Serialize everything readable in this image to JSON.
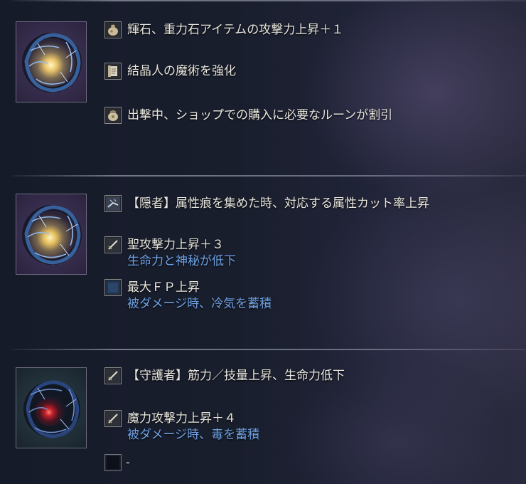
{
  "relics": [
    {
      "icon": "purple-golden-relic",
      "effects": [
        {
          "icon": "stone-pouch-icon",
          "text": "輝石、重力石アイテムの攻撃力上昇＋１"
        },
        {
          "icon": "scroll-icon",
          "text": "結晶人の魔術を強化"
        },
        {
          "icon": "rune-bag-icon",
          "text": "出撃中、ショップでの購入に必要なルーンが割引"
        }
      ]
    },
    {
      "icon": "purple-golden-relic",
      "effects": [
        {
          "icon": "affinity-icon",
          "text": "【隠者】属性痕を集めた時、対応する属性カット率上昇"
        },
        {
          "icon": "sword-icon",
          "text": "聖攻撃力上昇＋３",
          "sub": "生命力と神秘が低下"
        },
        {
          "icon": "fp-icon",
          "text": "最大ＦＰ上昇",
          "sub": "被ダメージ時、冷気を蓄積"
        }
      ]
    },
    {
      "icon": "dark-red-relic",
      "effects": [
        {
          "icon": "sword-icon",
          "text": "【守護者】筋力／技量上昇、生命力低下"
        },
        {
          "icon": "sword-icon",
          "text": "魔力攻撃力上昇＋４",
          "sub": "被ダメージ時、毒を蓄積"
        },
        {
          "icon": "empty-slot-icon",
          "text": "-"
        }
      ]
    }
  ],
  "colors": {
    "primary_text": "#e8e6de",
    "secondary_text": "#6fa3e6",
    "divider": "#bec3d2"
  }
}
